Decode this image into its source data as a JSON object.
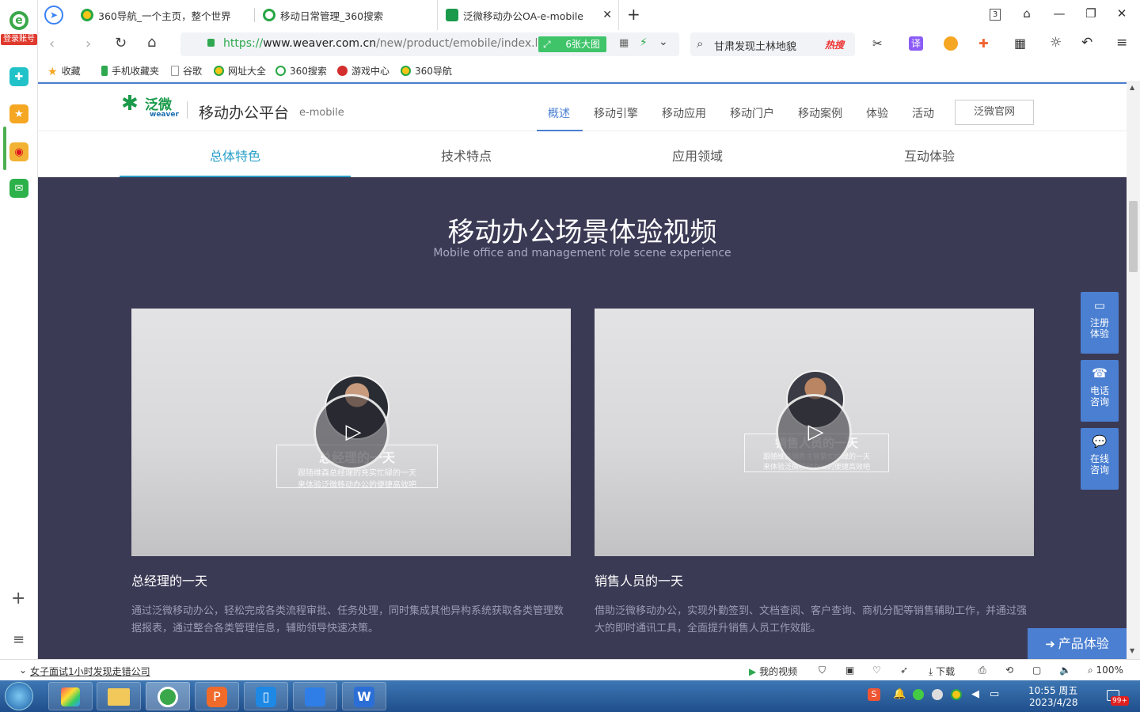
{
  "sidebar": {
    "login_label": "登录账号",
    "items": [
      "login-icon",
      "health-icon",
      "favorite-star-icon",
      "weibo-icon",
      "mail-icon"
    ],
    "add_label": "+",
    "list_label": "≡"
  },
  "tabs": [
    {
      "title": "360导航_一个主页，整个世界"
    },
    {
      "title": "移动日常管理_360搜索"
    },
    {
      "title": "泛微移动办公OA-e-mobile"
    }
  ],
  "tab_count": "3",
  "address": {
    "url_scheme": "https://",
    "url_host": "www.weaver.com.cn",
    "url_path": "/new/product/emobile/index.ht",
    "bigimage_label": "6张大图",
    "search_text": "甘肃发现土林地貌",
    "hot_label": "热搜",
    "translate_label": "译"
  },
  "bookmarks": [
    "收藏",
    "手机收藏夹",
    "谷歌",
    "网址大全",
    "360搜索",
    "游戏中心",
    "360导航"
  ],
  "site": {
    "logo_cn": "泛微",
    "logo_en": "weaver",
    "platform_title": "移动办公平台",
    "platform_en": "e-mobile",
    "nav": [
      "概述",
      "移动引擎",
      "移动应用",
      "移动门户",
      "移动案例",
      "体验",
      "活动"
    ],
    "nav_active_index": 0,
    "official_button": "泛微官网",
    "subnav": [
      "总体特色",
      "技术特点",
      "应用领域",
      "互动体验"
    ],
    "subnav_active_index": 0
  },
  "hero": {
    "title": "移动办公场景体验视频",
    "subtitle": "Mobile office and management role scene experience",
    "videos": [
      {
        "overlay_title": "总经理的一天",
        "overlay_line1": "跟随维森总经理的充实忙碌的一天",
        "overlay_line2": "来体验泛微移动办公的便捷高效吧",
        "title": "总经理的一天",
        "desc": "通过泛微移动办公，轻松完成各类流程审批、任务处理，同时集成其他异构系统获取各类管理数据报表，通过整合各类管理信息，辅助领导快速决策。"
      },
      {
        "overlay_title": "销售人员的一天",
        "overlay_line1": "跟随维森销售主管繁忙忙碌的一天",
        "overlay_line2": "来体验泛微移动办公的便捷高效吧",
        "title": "销售人员的一天",
        "desc": "借助泛微移动办公，实现外勤签到、文档查阅、客户查询、商机分配等销售辅助工作，并通过强大的即时通讯工具，全面提升销售人员工作效能。"
      }
    ]
  },
  "float_buttons": [
    {
      "label1": "注册",
      "label2": "体验"
    },
    {
      "label1": "电话",
      "label2": "咨询"
    },
    {
      "label1": "在线",
      "label2": "咨询"
    }
  ],
  "product_exp_button": "产品体验",
  "status": {
    "news": "女子面试1小时发现走错公司",
    "my_video": "我的视频",
    "download": "下载",
    "zoom": "100%"
  },
  "taskbar": {
    "time": "10:55 周五",
    "date": "2023/4/28",
    "badge": "99+"
  },
  "colors": {
    "accent": "#4a7fd1",
    "hero_bg": "#3b3a55",
    "subnav_active": "#2aa0c8",
    "brand_green": "#1a9a4a"
  }
}
